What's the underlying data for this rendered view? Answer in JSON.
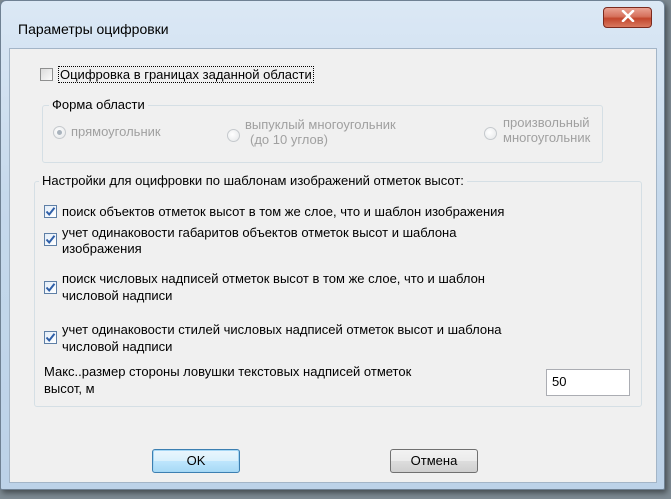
{
  "window": {
    "title": "Параметры оцифровки",
    "close_icon": "close-icon"
  },
  "area_digitize": {
    "checkbox_label": "Оцифровка  в границах заданной области",
    "checked": false
  },
  "area_shape": {
    "group_label": "Форма области",
    "options": [
      {
        "label": "прямоугольник",
        "selected": true
      },
      {
        "label_line1": "выпуклый многоугольник",
        "label_line2": "(до 10 углов)",
        "selected": false
      },
      {
        "label_line1": "произвольный",
        "label_line2": "многоугольник",
        "selected": false
      }
    ]
  },
  "template_settings": {
    "group_label": "Настройки  для оцифровки по шаблонам изображений отметок высот:",
    "options": [
      {
        "line1": "поиск объектов отметок высот  в том же слое,  что и шаблон изображения",
        "line2": "",
        "checked": true
      },
      {
        "line1": "учет одинаковости габаритов   объектов отметок высот  и шаблона",
        "line2": "изображения",
        "checked": true
      },
      {
        "line1": "поиск  числовых надписей отметок высот  в том же слое, что и шаблон",
        "line2": "числовой надписи",
        "checked": true
      },
      {
        "line1": "учет  одинаковости  стилей  числовых надписей отметок высот и шаблона",
        "line2": "числовой надписи",
        "checked": true
      }
    ],
    "max_size_label_line1": "Макс..размер стороны  ловушки текстовых надписей отметок",
    "max_size_label_line2": "высот, м",
    "max_size_value": "50"
  },
  "buttons": {
    "ok": "OK",
    "cancel": "Отмена"
  },
  "colors": {
    "checkmark": "#2f5fa8",
    "close_button": "#c2462d",
    "disabled_text": "#a0a0a0"
  }
}
